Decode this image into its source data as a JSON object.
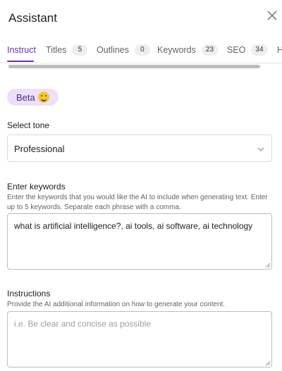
{
  "header": {
    "title": "Assistant"
  },
  "icons": {
    "close": "close-icon",
    "chevron": "chevron-down-icon",
    "resize": "resize-grip-icon",
    "emoji": "grinning-face-emoji"
  },
  "tabs": [
    {
      "label": "Instruct",
      "badge": ""
    },
    {
      "label": "Titles",
      "badge": "5"
    },
    {
      "label": "Outlines",
      "badge": "0"
    },
    {
      "label": "Keywords",
      "badge": "23"
    },
    {
      "label": "SEO",
      "badge": "34"
    },
    {
      "label": "H",
      "badge": ""
    }
  ],
  "beta": {
    "label": "Beta"
  },
  "tone": {
    "label": "Select tone",
    "value": "Professional"
  },
  "keywords": {
    "label": "Enter keywords",
    "help": "Enter the keywords that you would like the AI to include when generating text. Enter up to 5 keywords. Separate each phrase with a comma.",
    "value": "what is artificial intelligence?, ai tools, ai software, ai technology"
  },
  "instructions": {
    "label": "Instructions",
    "help": "Provide the AI additional information on how to generate your content.",
    "placeholder": "i.e. Be clear and concise as possible"
  },
  "colors": {
    "accent": "#6b2fb3",
    "beta_bg": "#ede0fa"
  }
}
